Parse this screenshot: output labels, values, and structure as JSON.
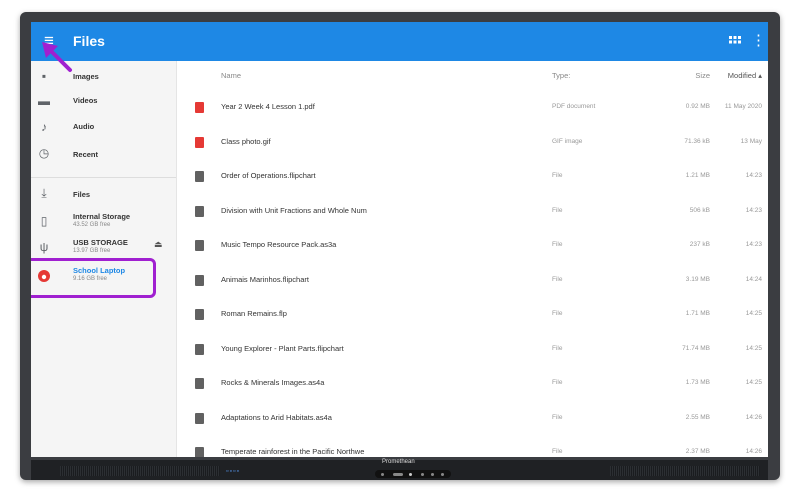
{
  "app": {
    "title": "Files"
  },
  "sidebar": {
    "items": [
      {
        "label": "Images",
        "icon": "image-icon"
      },
      {
        "label": "Videos",
        "icon": "video-icon"
      },
      {
        "label": "Audio",
        "icon": "audio-icon"
      },
      {
        "label": "Recent",
        "icon": "clock-icon"
      }
    ],
    "storage": [
      {
        "label": "Files",
        "sub": "",
        "icon": "download-icon"
      },
      {
        "label": "Internal Storage",
        "sub": "43.52 GB free",
        "icon": "phone-icon"
      },
      {
        "label": "USB STORAGE",
        "sub": "13.97 GB free",
        "icon": "usb-icon"
      },
      {
        "label": "School Laptop",
        "sub": "9.16 GB free",
        "icon": "laptop-drive-icon"
      }
    ]
  },
  "table": {
    "headers": {
      "name": "Name",
      "type": "Type:",
      "size": "Size",
      "modified": "Modified ▴"
    },
    "rows": [
      {
        "name": "Year 2 Week 4 Lesson 1.pdf",
        "type": "PDF document",
        "size": "0.92 MB",
        "modified": "11 May 2020",
        "icon": "pdf-icon"
      },
      {
        "name": "Class photo.gif",
        "type": "GIF image",
        "size": "71.36 kB",
        "modified": "13 May",
        "icon": "image-file-icon"
      },
      {
        "name": "Order of Operations.flipchart",
        "type": "File",
        "size": "1.21 MB",
        "modified": "14:23",
        "icon": "file-icon"
      },
      {
        "name": "Division with Unit Fractions and Whole Num",
        "type": "File",
        "size": "506 kB",
        "modified": "14:23",
        "icon": "file-icon"
      },
      {
        "name": "Music Tempo Resource Pack.as3a",
        "type": "File",
        "size": "237 kB",
        "modified": "14:23",
        "icon": "file-icon"
      },
      {
        "name": "Animais Marinhos.flipchart",
        "type": "File",
        "size": "3.19 MB",
        "modified": "14:24",
        "icon": "file-icon"
      },
      {
        "name": "Roman Remains.flp",
        "type": "File",
        "size": "1.71 MB",
        "modified": "14:25",
        "icon": "file-icon"
      },
      {
        "name": "Young Explorer - Plant Parts.flipchart",
        "type": "File",
        "size": "71.74 MB",
        "modified": "14:25",
        "icon": "file-icon"
      },
      {
        "name": "Rocks & Minerals Images.as4a",
        "type": "File",
        "size": "1.73 MB",
        "modified": "14:25",
        "icon": "file-icon"
      },
      {
        "name": "Adaptations to Arid Habitats.as4a",
        "type": "File",
        "size": "2.55 MB",
        "modified": "14:26",
        "icon": "file-icon"
      },
      {
        "name": "Temperate rainforest in the Pacific Northwe",
        "type": "File",
        "size": "2.37 MB",
        "modified": "14:26",
        "icon": "file-icon"
      }
    ]
  },
  "device": {
    "brand": "Promethean"
  },
  "colors": {
    "appbar": "#1e88e5",
    "highlight": "#a020d0",
    "pdf": "#e53935",
    "gif": "#e53935",
    "active": "#1e88e5"
  }
}
